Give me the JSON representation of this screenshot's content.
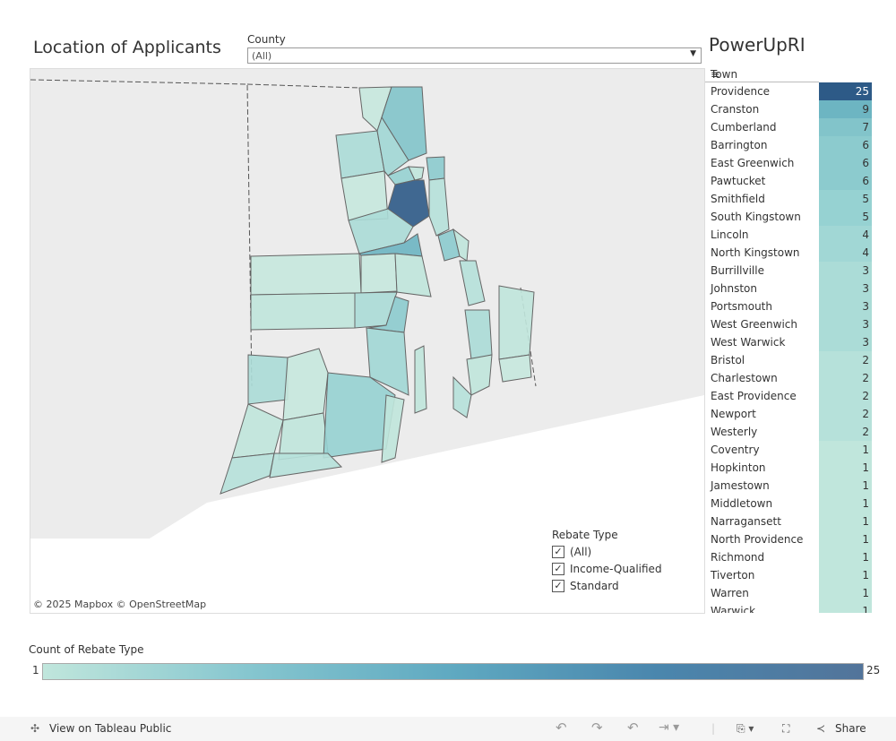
{
  "header": {
    "title": "Location of Applicants",
    "brand": "PowerUpRI"
  },
  "filter": {
    "label": "County",
    "value": "(All)"
  },
  "table": {
    "column_header": "Town",
    "rows": [
      {
        "town": "Providence",
        "count": 25
      },
      {
        "town": "Cranston",
        "count": 9
      },
      {
        "town": "Cumberland",
        "count": 7
      },
      {
        "town": "Barrington",
        "count": 6
      },
      {
        "town": "East Greenwich",
        "count": 6
      },
      {
        "town": "Pawtucket",
        "count": 6
      },
      {
        "town": "Smithfield",
        "count": 5
      },
      {
        "town": "South Kingstown",
        "count": 5
      },
      {
        "town": "Lincoln",
        "count": 4
      },
      {
        "town": "North Kingstown",
        "count": 4
      },
      {
        "town": "Burrillville",
        "count": 3
      },
      {
        "town": "Johnston",
        "count": 3
      },
      {
        "town": "Portsmouth",
        "count": 3
      },
      {
        "town": "West Greenwich",
        "count": 3
      },
      {
        "town": "West Warwick",
        "count": 3
      },
      {
        "town": "Bristol",
        "count": 2
      },
      {
        "town": "Charlestown",
        "count": 2
      },
      {
        "town": "East Providence",
        "count": 2
      },
      {
        "town": "Newport",
        "count": 2
      },
      {
        "town": "Westerly",
        "count": 2
      },
      {
        "town": "Coventry",
        "count": 1
      },
      {
        "town": "Hopkinton",
        "count": 1
      },
      {
        "town": "Jamestown",
        "count": 1
      },
      {
        "town": "Middletown",
        "count": 1
      },
      {
        "town": "Narragansett",
        "count": 1
      },
      {
        "town": "North Providence",
        "count": 1
      },
      {
        "town": "Richmond",
        "count": 1
      },
      {
        "town": "Tiverton",
        "count": 1
      },
      {
        "town": "Warren",
        "count": 1
      },
      {
        "town": "Warwick",
        "count": 1
      }
    ]
  },
  "legend": {
    "title": "Rebate Type",
    "items": [
      {
        "label": "(All)",
        "checked": true
      },
      {
        "label": "Income-Qualified",
        "checked": true
      },
      {
        "label": "Standard",
        "checked": true
      }
    ]
  },
  "map": {
    "attribution": "© 2025 Mapbox  © OpenStreetMap"
  },
  "color_scale": {
    "label": "Count of Rebate Type",
    "min": "1",
    "max": "25",
    "min_color": "#c0e6dc",
    "max_color": "#2d5a87"
  },
  "footer": {
    "view_label": "View on Tableau Public",
    "share_label": "Share"
  }
}
